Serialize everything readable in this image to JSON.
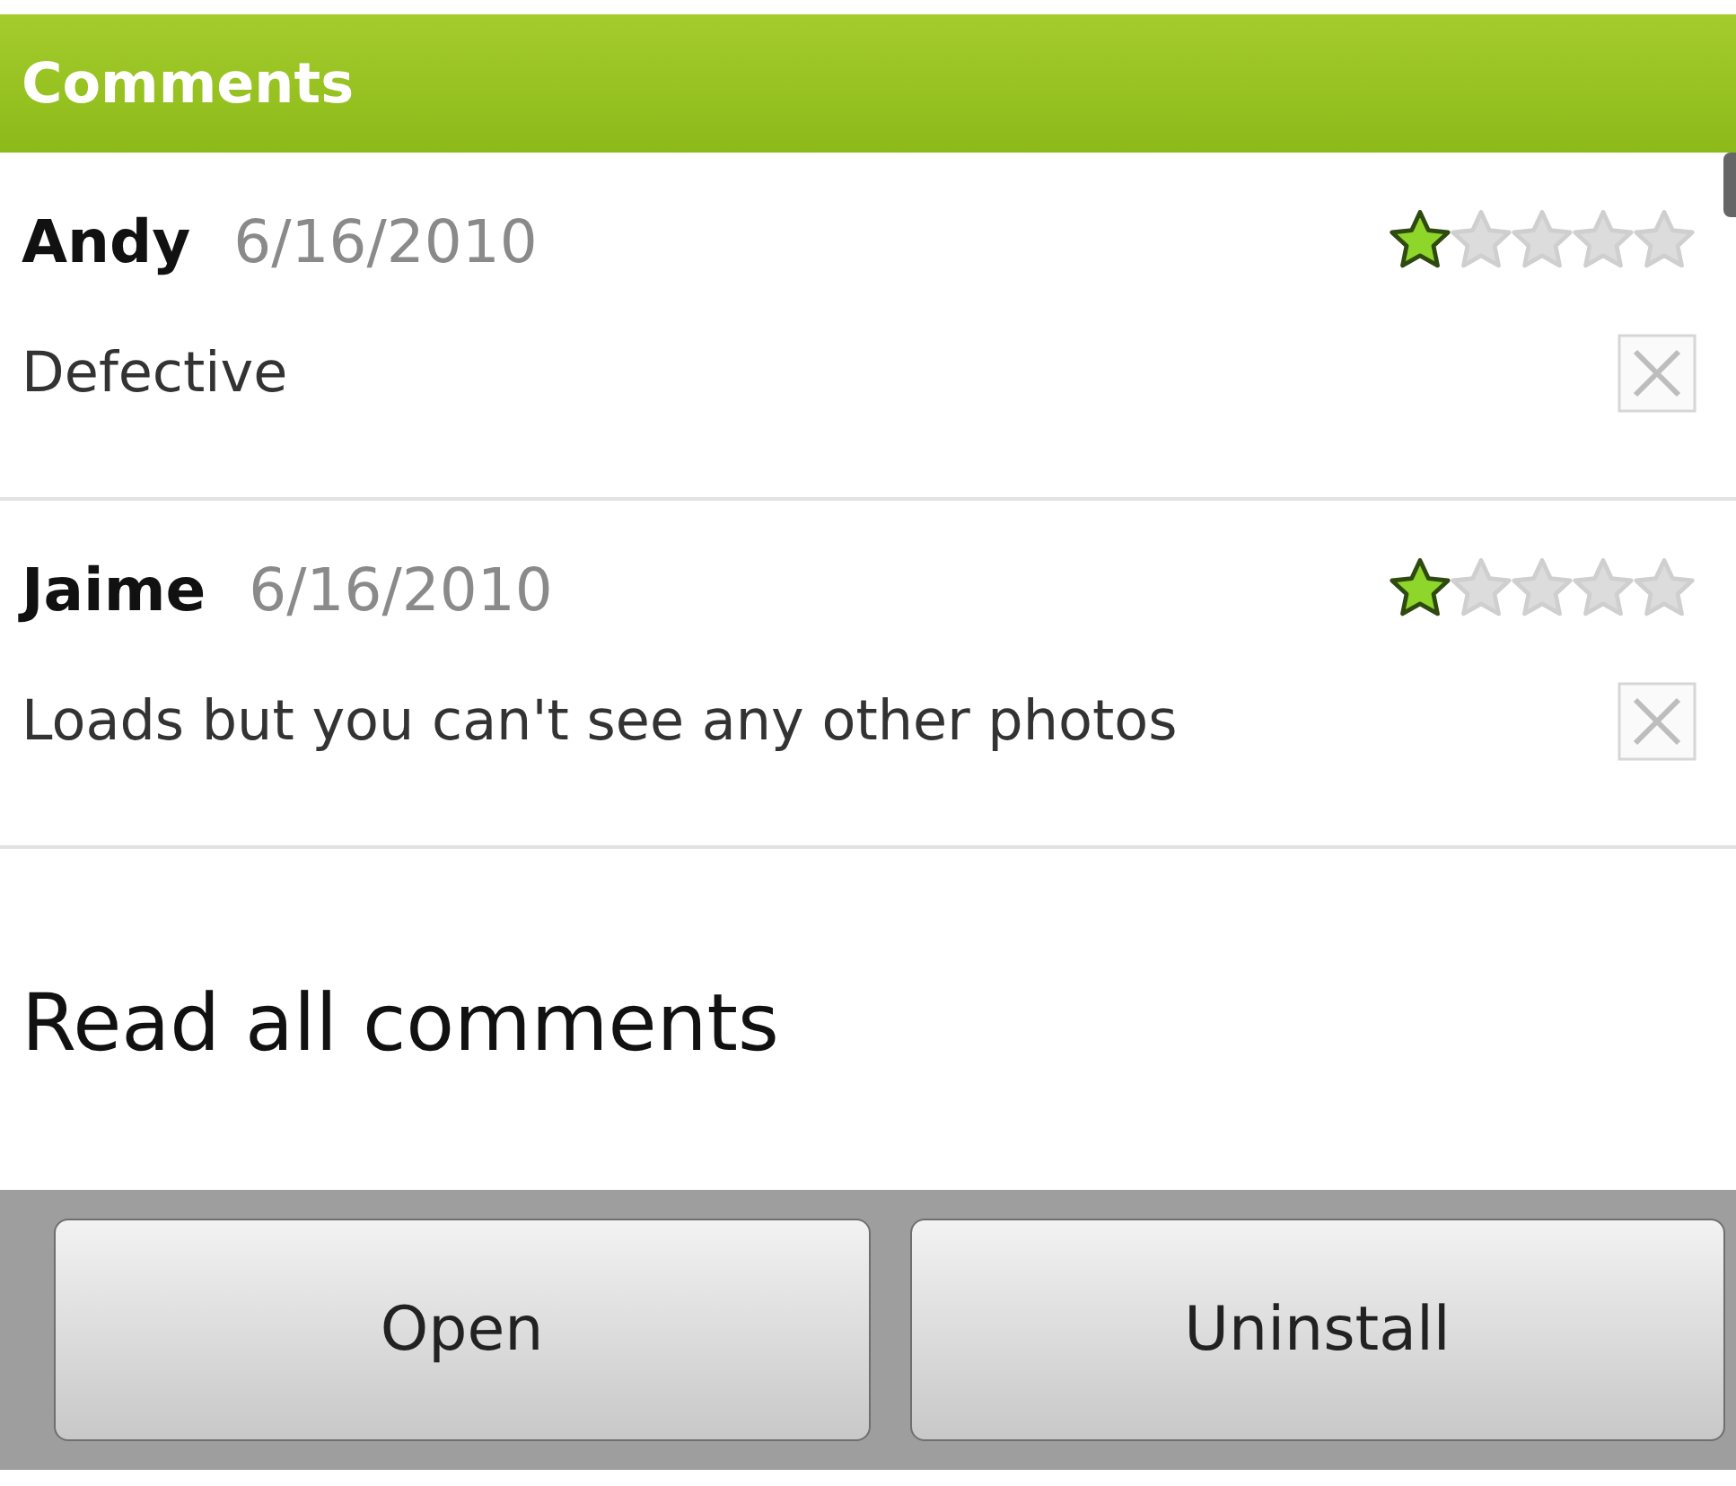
{
  "header": {
    "title": "Comments"
  },
  "comments": [
    {
      "author": "Andy",
      "date": "6/16/2010",
      "stars": 1,
      "text": "Defective"
    },
    {
      "author": "Jaime",
      "date": "6/16/2010",
      "stars": 1,
      "text": "Loads but you can't see any other photos"
    }
  ],
  "read_all": "Read all comments",
  "buttons": [
    "Open",
    "Uninstall"
  ]
}
